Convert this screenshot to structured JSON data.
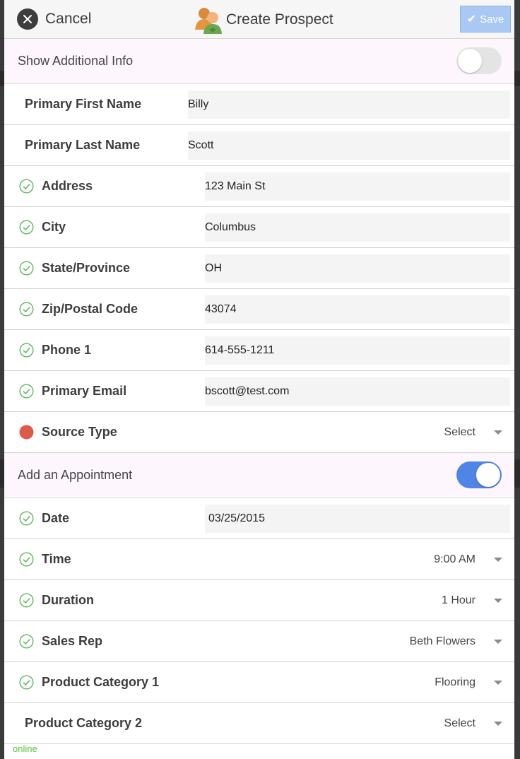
{
  "header": {
    "cancel_label": "Cancel",
    "title": "Create Prospect",
    "save_label": "Save"
  },
  "show_additional_info": {
    "label": "Show Additional Info",
    "enabled": false
  },
  "prospect_fields": [
    {
      "label": "Primary First Name",
      "value": "Billy",
      "status": "none"
    },
    {
      "label": "Primary Last Name",
      "value": "Scott",
      "status": "none"
    },
    {
      "label": "Address",
      "value": "123 Main St",
      "status": "valid"
    },
    {
      "label": "City",
      "value": "Columbus",
      "status": "valid"
    },
    {
      "label": "State/Province",
      "value": "OH",
      "status": "valid"
    },
    {
      "label": "Zip/Postal Code",
      "value": "43074",
      "status": "valid"
    },
    {
      "label": "Phone 1",
      "value": "614-555-1211",
      "status": "valid"
    },
    {
      "label": "Primary Email",
      "value": "bscott@test.com",
      "status": "valid"
    }
  ],
  "source_type": {
    "label": "Source Type",
    "value": "Select",
    "status": "required"
  },
  "add_appointment": {
    "label": "Add an Appointment",
    "enabled": true
  },
  "appointment": {
    "date": {
      "label": "Date",
      "value": "03/25/2015",
      "status": "valid"
    },
    "time": {
      "label": "Time",
      "value": "9:00 AM",
      "status": "valid"
    },
    "duration": {
      "label": "Duration",
      "value": "1 Hour",
      "status": "valid"
    },
    "sales_rep": {
      "label": "Sales Rep",
      "value": "Beth Flowers",
      "status": "valid"
    },
    "product_category_1": {
      "label": "Product Category 1",
      "value": "Flooring",
      "status": "valid"
    },
    "product_category_2": {
      "label": "Product Category 2",
      "value": "Select",
      "status": "none"
    }
  },
  "connection_status": "online",
  "colors": {
    "valid": "#5cb85c",
    "required": "#e05a4a",
    "toggle_on": "#4f86e6",
    "save_disabled": "#a9c8f4",
    "status_online": "#5fbf3a"
  }
}
